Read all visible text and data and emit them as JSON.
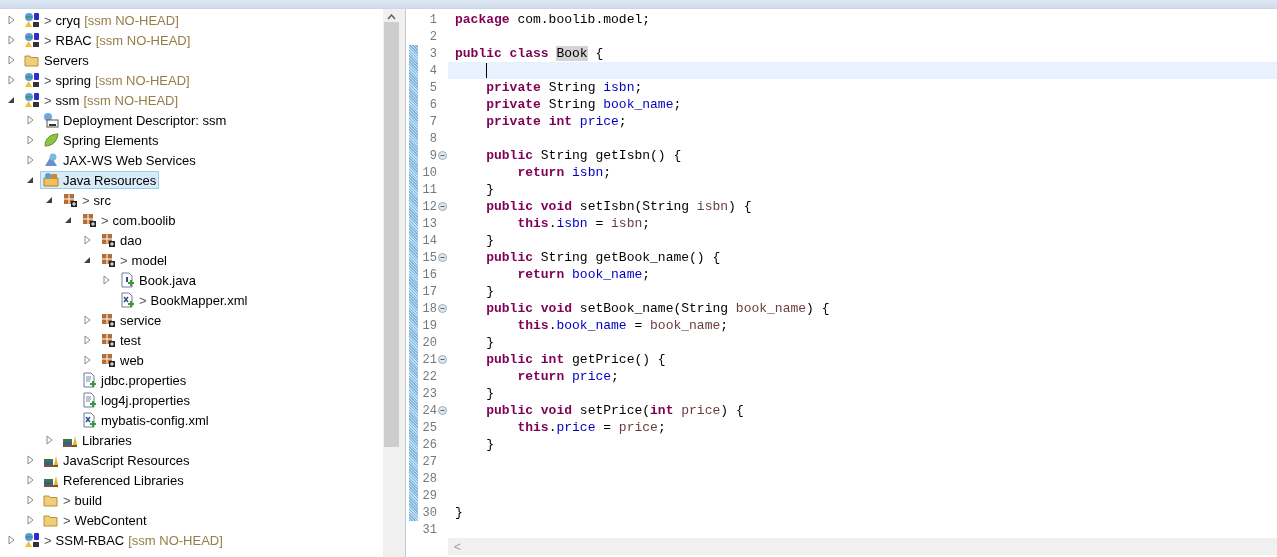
{
  "explorer": {
    "items": [
      {
        "kind": "project",
        "prefix": ">",
        "label": "cryq",
        "repo": "[ssm NO-HEAD]",
        "expanded": false,
        "selected": false
      },
      {
        "kind": "project",
        "prefix": ">",
        "label": "RBAC",
        "repo": "[ssm NO-HEAD]",
        "expanded": false,
        "selected": false
      },
      {
        "kind": "folder",
        "label": "Servers",
        "expanded": false,
        "selected": false
      },
      {
        "kind": "project",
        "prefix": ">",
        "label": "spring",
        "repo": "[ssm NO-HEAD]",
        "expanded": false,
        "selected": false
      },
      {
        "kind": "project",
        "prefix": ">",
        "label": "ssm",
        "repo": "[ssm NO-HEAD]",
        "expanded": true,
        "selected": false,
        "children": [
          {
            "kind": "descriptor",
            "label": "Deployment Descriptor: ssm",
            "expanded": false,
            "selected": false
          },
          {
            "kind": "spring",
            "label": "Spring Elements",
            "expanded": false,
            "selected": false
          },
          {
            "kind": "webservices",
            "label": "JAX-WS Web Services",
            "expanded": false,
            "selected": false
          },
          {
            "kind": "resources",
            "label": "Java Resources",
            "expanded": true,
            "selected": true,
            "children": [
              {
                "kind": "package",
                "prefix": ">",
                "label": "src",
                "expanded": true,
                "selected": false,
                "children": [
                  {
                    "kind": "package",
                    "prefix": ">",
                    "label": "com.boolib",
                    "expanded": true,
                    "selected": false,
                    "children": [
                      {
                        "kind": "package",
                        "label": "dao",
                        "expanded": false,
                        "selected": false
                      },
                      {
                        "kind": "package",
                        "prefix": ">",
                        "label": "model",
                        "expanded": true,
                        "selected": false,
                        "children": [
                          {
                            "kind": "java",
                            "label": "Book.java",
                            "expanded": false,
                            "selected": false
                          },
                          {
                            "kind": "xml",
                            "prefix": ">",
                            "label": "BookMapper.xml",
                            "selected": false
                          }
                        ]
                      },
                      {
                        "kind": "package",
                        "label": "service",
                        "expanded": false,
                        "selected": false
                      },
                      {
                        "kind": "package",
                        "label": "test",
                        "expanded": false,
                        "selected": false
                      },
                      {
                        "kind": "package",
                        "label": "web",
                        "expanded": false,
                        "selected": false
                      }
                    ]
                  },
                  {
                    "kind": "properties",
                    "label": "jdbc.properties",
                    "selected": false
                  },
                  {
                    "kind": "properties",
                    "label": "log4j.properties",
                    "selected": false
                  },
                  {
                    "kind": "xml",
                    "label": "mybatis-config.xml",
                    "selected": false
                  }
                ]
              },
              {
                "kind": "library",
                "label": "Libraries",
                "expanded": false,
                "selected": false
              }
            ]
          },
          {
            "kind": "library",
            "label": "JavaScript Resources",
            "expanded": false,
            "selected": false
          },
          {
            "kind": "library",
            "label": "Referenced Libraries",
            "expanded": false,
            "selected": false
          },
          {
            "kind": "folder",
            "prefix": ">",
            "label": "build",
            "expanded": false,
            "selected": false
          },
          {
            "kind": "folder",
            "prefix": ">",
            "label": "WebContent",
            "expanded": false,
            "selected": false
          }
        ]
      },
      {
        "kind": "project",
        "prefix": ">",
        "label": "SSM-RBAC",
        "repo": "[ssm NO-HEAD]",
        "expanded": false,
        "selected": false
      }
    ]
  },
  "editor": {
    "lines": [
      {
        "number": "1",
        "tokens": [
          {
            "kind": "kw",
            "text": "package"
          },
          {
            "kind": "plain",
            "text": " com.boolib.model;"
          }
        ]
      },
      {
        "number": "2"
      },
      {
        "number": "3",
        "changed": true,
        "tokens": [
          {
            "kind": "kw",
            "text": "public"
          },
          {
            "kind": "kw",
            "text": " class "
          },
          {
            "kind": "mark",
            "text": "Book"
          },
          {
            "kind": "plain",
            "text": " {"
          }
        ]
      },
      {
        "number": "4",
        "changed": true,
        "current": true
      },
      {
        "number": "5",
        "changed": true,
        "tokens": [
          {
            "kind": "kw",
            "text": "    private"
          },
          {
            "kind": "plain",
            "text": " String "
          },
          {
            "kind": "field",
            "text": "isbn"
          },
          {
            "kind": "plain",
            "text": ";"
          }
        ]
      },
      {
        "number": "6",
        "changed": true,
        "tokens": [
          {
            "kind": "kw",
            "text": "    private"
          },
          {
            "kind": "plain",
            "text": " String "
          },
          {
            "kind": "field",
            "text": "book_name"
          },
          {
            "kind": "plain",
            "text": ";"
          }
        ]
      },
      {
        "number": "7",
        "changed": true,
        "tokens": [
          {
            "kind": "kw",
            "text": "    private"
          },
          {
            "kind": "kw",
            "text": " int "
          },
          {
            "kind": "field",
            "text": "price"
          },
          {
            "kind": "plain",
            "text": ";"
          }
        ]
      },
      {
        "number": "8",
        "changed": true
      },
      {
        "number": "9",
        "changed": true,
        "fold": true,
        "tokens": [
          {
            "kind": "kw",
            "text": "    public"
          },
          {
            "kind": "plain",
            "text": " String getIsbn() {"
          }
        ]
      },
      {
        "number": "10",
        "changed": true,
        "tokens": [
          {
            "kind": "kw",
            "text": "        return "
          },
          {
            "kind": "field",
            "text": "isbn"
          },
          {
            "kind": "plain",
            "text": ";"
          }
        ]
      },
      {
        "number": "11",
        "changed": true,
        "tokens": [
          {
            "kind": "plain",
            "text": "    }"
          }
        ]
      },
      {
        "number": "12",
        "changed": true,
        "fold": true,
        "tokens": [
          {
            "kind": "kw",
            "text": "    public"
          },
          {
            "kind": "kw",
            "text": " void"
          },
          {
            "kind": "plain",
            "text": " setIsbn(String "
          },
          {
            "kind": "param",
            "text": "isbn"
          },
          {
            "kind": "plain",
            "text": ") {"
          }
        ]
      },
      {
        "number": "13",
        "changed": true,
        "tokens": [
          {
            "kind": "kw",
            "text": "        this"
          },
          {
            "kind": "plain",
            "text": "."
          },
          {
            "kind": "field",
            "text": "isbn"
          },
          {
            "kind": "plain",
            "text": " = "
          },
          {
            "kind": "param",
            "text": "isbn"
          },
          {
            "kind": "plain",
            "text": ";"
          }
        ]
      },
      {
        "number": "14",
        "changed": true,
        "tokens": [
          {
            "kind": "plain",
            "text": "    }"
          }
        ]
      },
      {
        "number": "15",
        "changed": true,
        "fold": true,
        "tokens": [
          {
            "kind": "kw",
            "text": "    public"
          },
          {
            "kind": "plain",
            "text": " String getBook_name() {"
          }
        ]
      },
      {
        "number": "16",
        "changed": true,
        "tokens": [
          {
            "kind": "kw",
            "text": "        return "
          },
          {
            "kind": "field",
            "text": "book_name"
          },
          {
            "kind": "plain",
            "text": ";"
          }
        ]
      },
      {
        "number": "17",
        "changed": true,
        "tokens": [
          {
            "kind": "plain",
            "text": "    }"
          }
        ]
      },
      {
        "number": "18",
        "changed": true,
        "fold": true,
        "tokens": [
          {
            "kind": "kw",
            "text": "    public"
          },
          {
            "kind": "kw",
            "text": " void"
          },
          {
            "kind": "plain",
            "text": " setBook_name(String "
          },
          {
            "kind": "param",
            "text": "book_name"
          },
          {
            "kind": "plain",
            "text": ") {"
          }
        ]
      },
      {
        "number": "19",
        "changed": true,
        "tokens": [
          {
            "kind": "kw",
            "text": "        this"
          },
          {
            "kind": "plain",
            "text": "."
          },
          {
            "kind": "field",
            "text": "book_name"
          },
          {
            "kind": "plain",
            "text": " = "
          },
          {
            "kind": "param",
            "text": "book_name"
          },
          {
            "kind": "plain",
            "text": ";"
          }
        ]
      },
      {
        "number": "20",
        "changed": true,
        "tokens": [
          {
            "kind": "plain",
            "text": "    }"
          }
        ]
      },
      {
        "number": "21",
        "changed": true,
        "fold": true,
        "tokens": [
          {
            "kind": "kw",
            "text": "    public"
          },
          {
            "kind": "kw",
            "text": " int"
          },
          {
            "kind": "plain",
            "text": " getPrice() {"
          }
        ]
      },
      {
        "number": "22",
        "changed": true,
        "tokens": [
          {
            "kind": "kw",
            "text": "        return "
          },
          {
            "kind": "field",
            "text": "price"
          },
          {
            "kind": "plain",
            "text": ";"
          }
        ]
      },
      {
        "number": "23",
        "changed": true,
        "tokens": [
          {
            "kind": "plain",
            "text": "    }"
          }
        ]
      },
      {
        "number": "24",
        "changed": true,
        "fold": true,
        "tokens": [
          {
            "kind": "kw",
            "text": "    public"
          },
          {
            "kind": "kw",
            "text": " void"
          },
          {
            "kind": "plain",
            "text": " setPrice("
          },
          {
            "kind": "kw",
            "text": "int "
          },
          {
            "kind": "param",
            "text": "price"
          },
          {
            "kind": "plain",
            "text": ") {"
          }
        ]
      },
      {
        "number": "25",
        "changed": true,
        "tokens": [
          {
            "kind": "kw",
            "text": "        this"
          },
          {
            "kind": "plain",
            "text": "."
          },
          {
            "kind": "field",
            "text": "price"
          },
          {
            "kind": "plain",
            "text": " = "
          },
          {
            "kind": "param",
            "text": "price"
          },
          {
            "kind": "plain",
            "text": ";"
          }
        ]
      },
      {
        "number": "26",
        "changed": true,
        "tokens": [
          {
            "kind": "plain",
            "text": "    }"
          }
        ]
      },
      {
        "number": "27",
        "changed": true
      },
      {
        "number": "28",
        "changed": true
      },
      {
        "number": "29",
        "changed": true
      },
      {
        "number": "30",
        "changed": true,
        "tokens": [
          {
            "kind": "plain",
            "text": "}"
          }
        ]
      },
      {
        "number": "31"
      }
    ],
    "scroll_left": "<"
  }
}
